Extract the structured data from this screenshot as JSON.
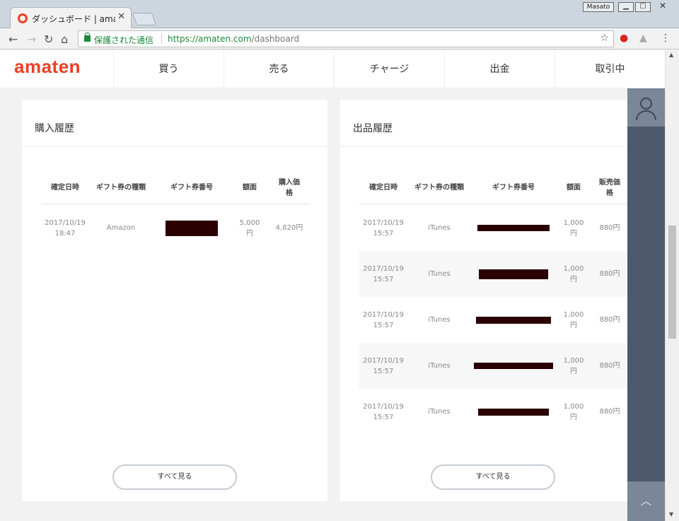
{
  "browser": {
    "tab_title": "ダッシュボード | amaten",
    "tab_close": "✕",
    "profile_name": "Masato",
    "secure_label": "保護された通信",
    "url_host": "https://amaten.com",
    "url_path": "/dashboard"
  },
  "site": {
    "logo": "amaten",
    "nav": [
      {
        "label": "買う"
      },
      {
        "label": "売る"
      },
      {
        "label": "チャージ"
      },
      {
        "label": "出金"
      },
      {
        "label": "取引中"
      }
    ]
  },
  "purchase_history": {
    "title": "購入履歴",
    "headers": [
      "確定日時",
      "ギフト券の種類",
      "ギフト券番号",
      "額面",
      "購入価格"
    ],
    "rows": [
      {
        "date": "2017/10/19",
        "time": "18:47",
        "type": "Amazon",
        "face": "5,000",
        "face_unit": "円",
        "price": "4,820円"
      }
    ],
    "more_label": "すべて見る"
  },
  "sales_history": {
    "title": "出品履歴",
    "headers": [
      "確定日時",
      "ギフト券の種類",
      "ギフト券番号",
      "額面",
      "販売価格"
    ],
    "rows": [
      {
        "date": "2017/10/19",
        "time": "15:57",
        "type": "iTunes",
        "face": "1,000",
        "face_unit": "円",
        "price": "880円"
      },
      {
        "date": "2017/10/19",
        "time": "15:57",
        "type": "iTunes",
        "face": "1,000",
        "face_unit": "円",
        "price": "880円"
      },
      {
        "date": "2017/10/19",
        "time": "15:57",
        "type": "iTunes",
        "face": "1,000",
        "face_unit": "円",
        "price": "880円"
      },
      {
        "date": "2017/10/19",
        "time": "15:57",
        "type": "iTunes",
        "face": "1,000",
        "face_unit": "円",
        "price": "880円"
      },
      {
        "date": "2017/10/19",
        "time": "15:57",
        "type": "iTunes",
        "face": "1,000",
        "face_unit": "円",
        "price": "880円"
      }
    ],
    "more_label": "すべて見る"
  },
  "icons": [
    "back-arrow-icon",
    "forward-arrow-icon",
    "reload-icon",
    "home-icon",
    "lock-icon",
    "star-icon",
    "menu-icon",
    "user-icon",
    "chevron-up-icon"
  ],
  "colors": {
    "brand": "#ef3e23",
    "sidebar": "#4d5a6d",
    "redaction": "#2a0000"
  }
}
